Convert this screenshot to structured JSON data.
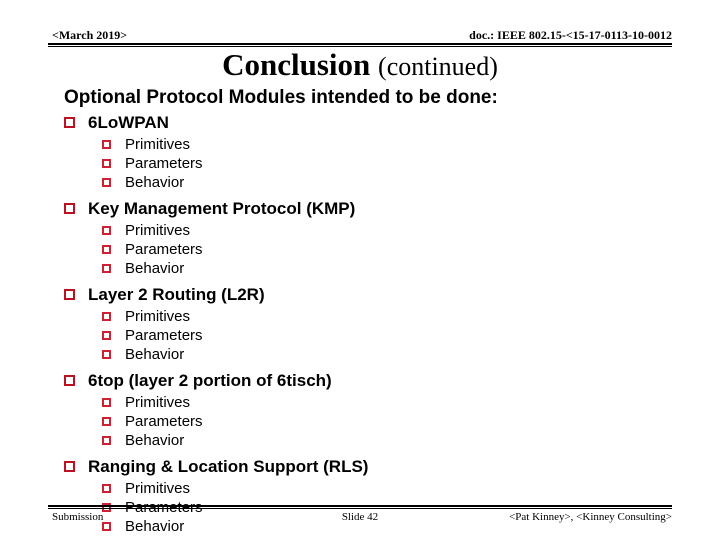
{
  "header": {
    "left": "<March 2019>",
    "right": "doc.: IEEE 802.15-<15-17-0113-10-0012"
  },
  "title": {
    "main": "Conclusion",
    "continued": "(continued)"
  },
  "subtitle": "Optional Protocol Modules intended to be done:",
  "bullet_color_level1": "#bb1122",
  "bullet_color_level2": "#cc2233",
  "groups": [
    {
      "title": "6LoWPAN",
      "items": [
        "Primitives",
        "Parameters",
        "Behavior"
      ]
    },
    {
      "title": "Key Management Protocol (KMP)",
      "items": [
        "Primitives",
        "Parameters",
        "Behavior"
      ]
    },
    {
      "title": "Layer 2 Routing (L2R)",
      "items": [
        "Primitives",
        "Parameters",
        "Behavior"
      ]
    },
    {
      "title": "6top (layer 2 portion of 6tisch)",
      "items": [
        "Primitives",
        "Parameters",
        "Behavior"
      ]
    },
    {
      "title": "Ranging & Location Support (RLS)",
      "items": [
        "Primitives",
        "Parameters",
        "Behavior"
      ]
    }
  ],
  "footer": {
    "left": "Submission",
    "center": "Slide 42",
    "right": "<Pat Kinney>, <Kinney Consulting>"
  }
}
